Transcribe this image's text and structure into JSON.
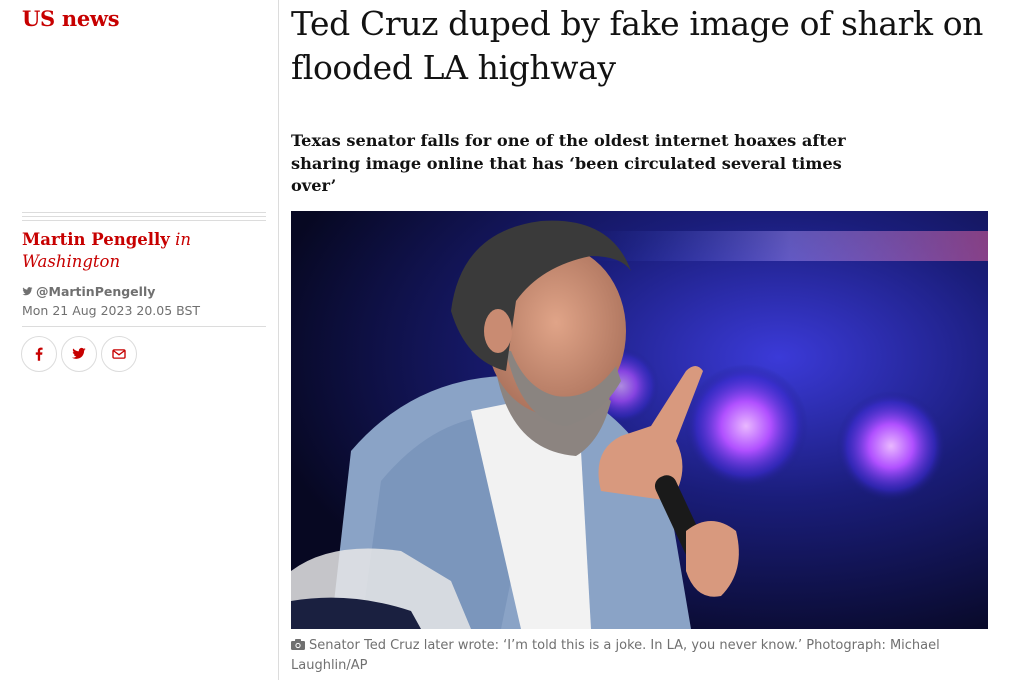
{
  "section": {
    "label": "US news",
    "accent_color": "#c70000"
  },
  "article": {
    "headline": "Ted Cruz duped by fake image of shark on flooded LA highway",
    "standfirst": "Texas senator falls for one of the oldest internet hoaxes after sharing image online that has ‘been circulated several times over’"
  },
  "byline": {
    "author": "Martin Pengelly",
    "location": "in Washington",
    "twitter_handle": "@MartinPengelly",
    "twitter_icon": "twitter-bird-icon",
    "date": "Mon 21 Aug 2023 20.05 BST"
  },
  "share": {
    "buttons": [
      {
        "icon": "facebook-icon"
      },
      {
        "icon": "twitter-icon"
      },
      {
        "icon": "email-icon"
      }
    ]
  },
  "image": {
    "caption": "Senator Ted Cruz later wrote: ‘I’m told this is a joke. In LA, you never know.’ Photograph: Michael Laughlin/AP",
    "caption_icon": "camera-icon"
  }
}
